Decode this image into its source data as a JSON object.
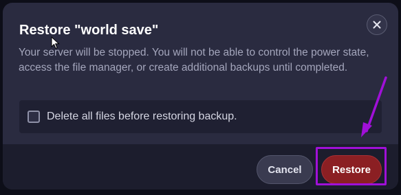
{
  "modal": {
    "title": "Restore \"world save\"",
    "description": "Your server will be stopped. You will not be able to control the power state, access the file manager, or create additional backups until completed.",
    "option": {
      "label": "Delete all files before restoring backup.",
      "checked": false
    },
    "buttons": {
      "cancel_label": "Cancel",
      "restore_label": "Restore"
    },
    "close_icon": "close-icon"
  },
  "colors": {
    "modal_background": "#2a2b40",
    "footer_background": "#1c1d2d",
    "restore_button": "#8b1f23",
    "annotation": "#a010d8"
  }
}
